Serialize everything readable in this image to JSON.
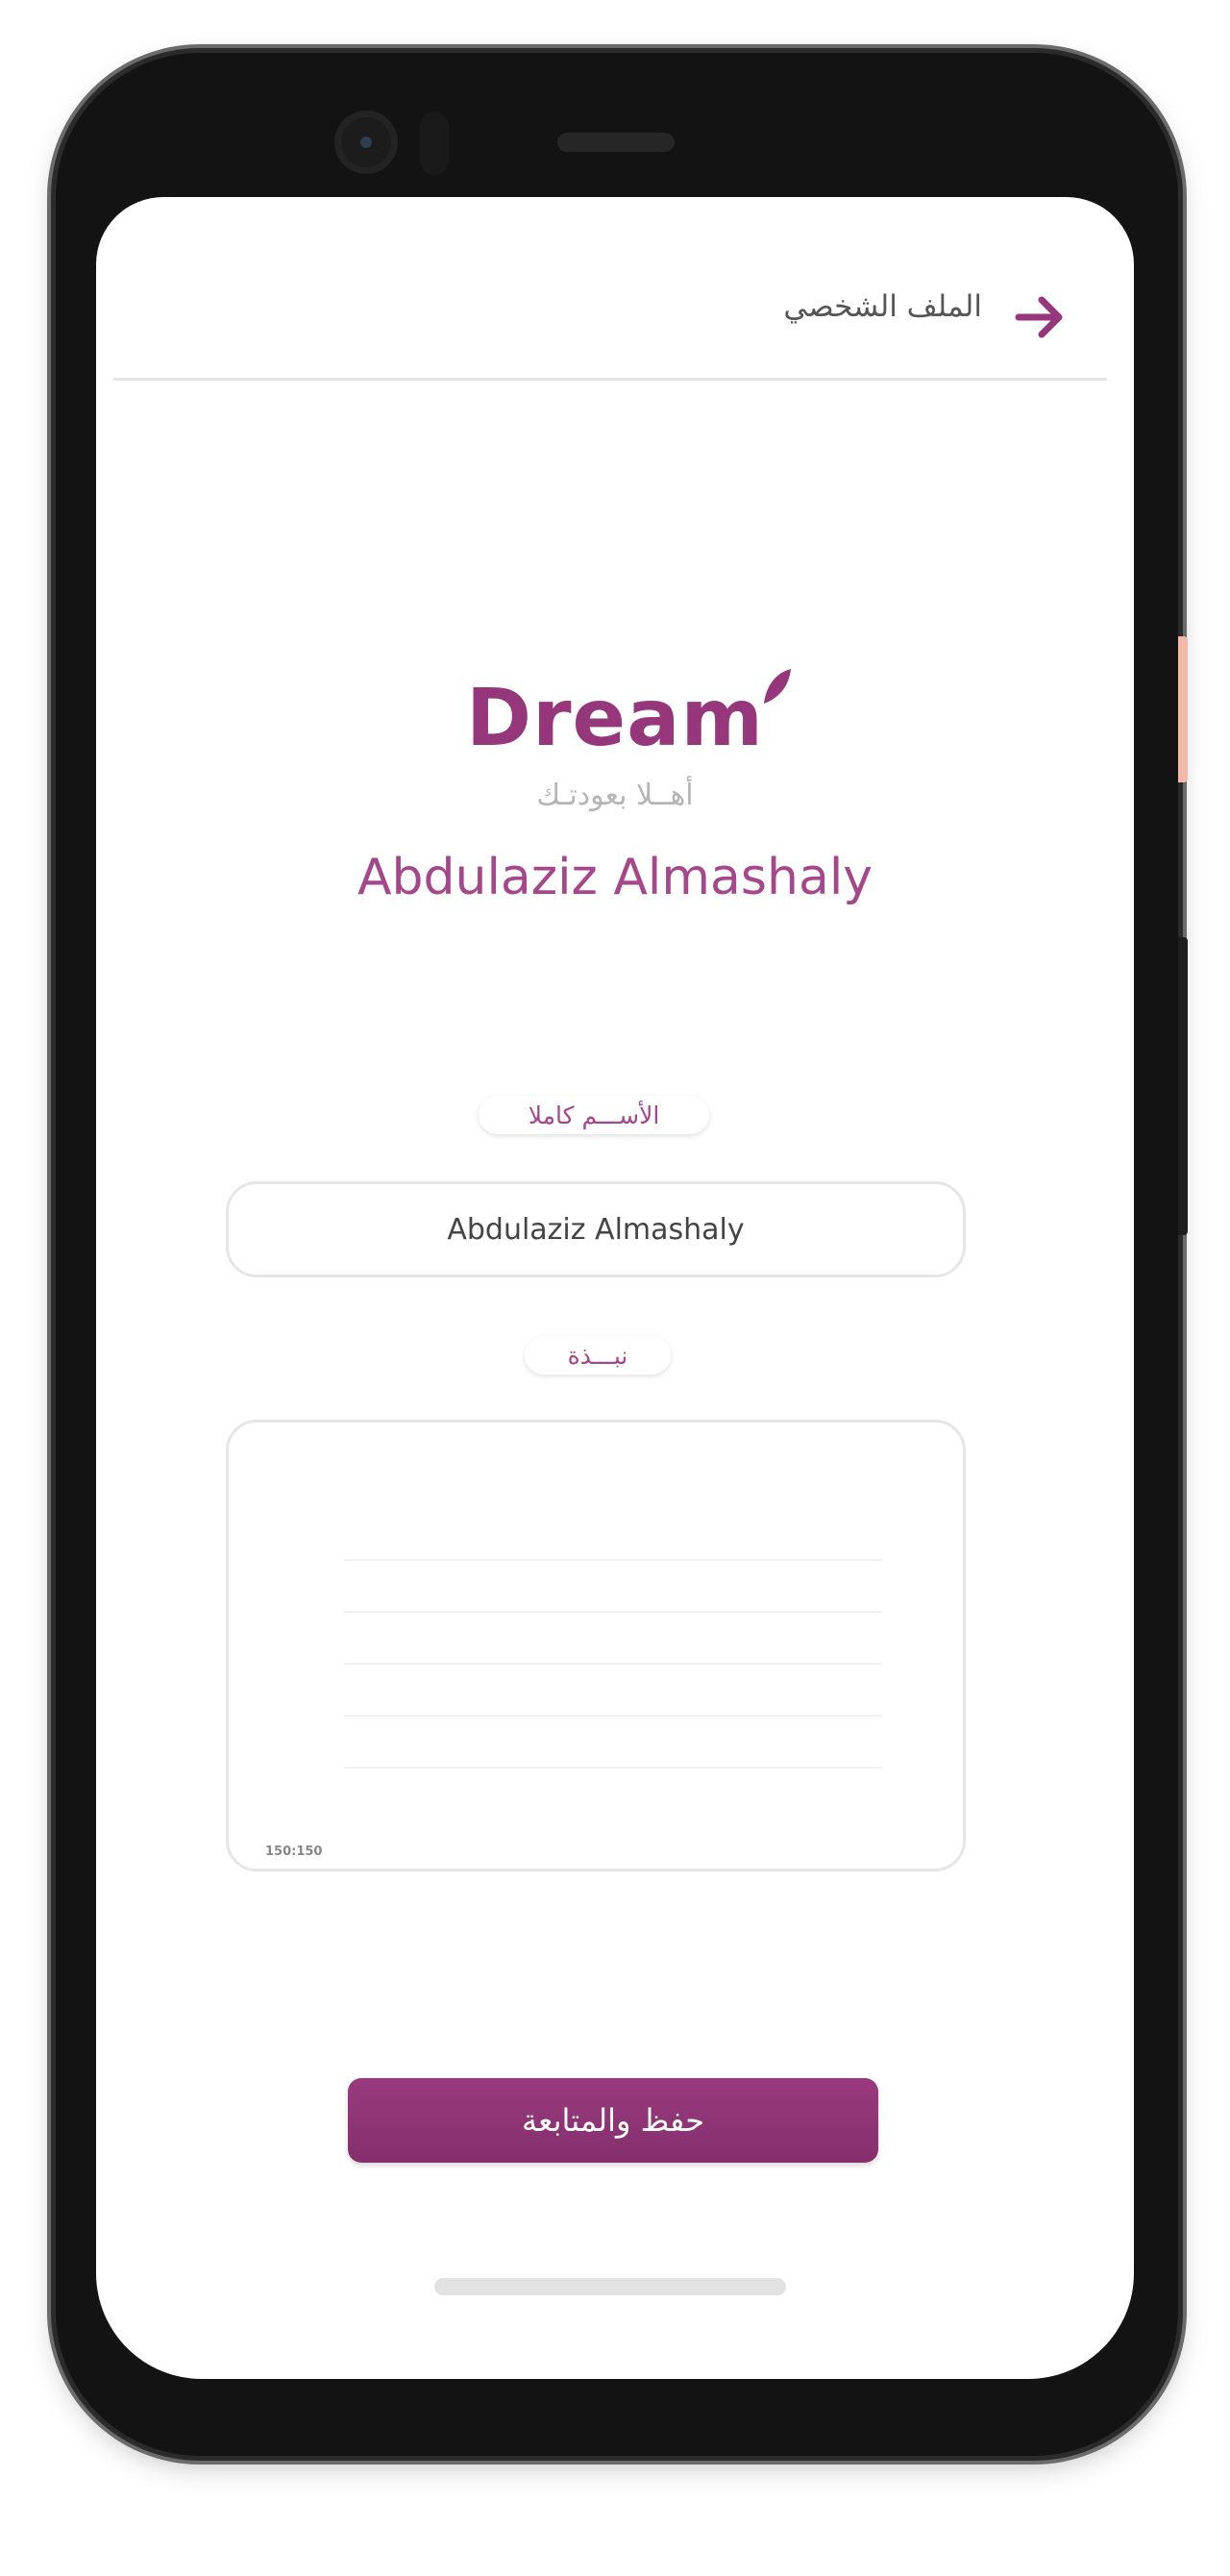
{
  "header": {
    "title": "الملف الشخصي",
    "back_icon": "arrow-right-icon"
  },
  "brand": {
    "logo_text": "Dream",
    "tagline": "أهــلا بعودتـك",
    "accent_color": "#97377b"
  },
  "profile": {
    "display_name": "Abdulaziz Almashaly"
  },
  "form": {
    "full_name_label": "الأســـم كاملا",
    "full_name_value": "Abdulaziz Almashaly",
    "bio_label": "نبـــذة",
    "bio_value": "",
    "bio_counter": "150:150"
  },
  "actions": {
    "save_label": "حفظ والمتابعة"
  }
}
